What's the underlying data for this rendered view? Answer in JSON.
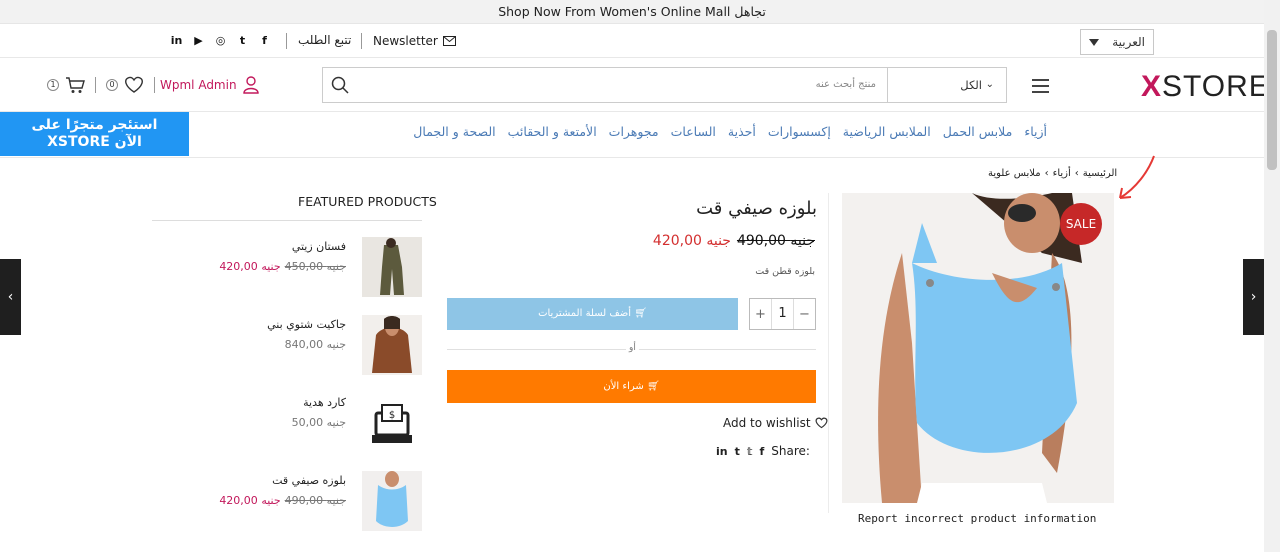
{
  "promo": {
    "text": "Shop Now From Women's Online Mall تجاهل"
  },
  "topbar": {
    "language": "العربية",
    "newsletter": "Newsletter",
    "track_order": "تتبع الطلب",
    "socials": [
      "in",
      "▶",
      "◎",
      "t",
      "f"
    ]
  },
  "header": {
    "logo_x": "X",
    "logo_rest": "STORE",
    "search_category": "الكل",
    "search_placeholder": "منتج أبحث عنه",
    "account_label": "Wpml Admin",
    "wishlist_count": "0",
    "cart_count": "1"
  },
  "nav": {
    "cta": "استئجر متجرًا على XSTORE الآن",
    "links": [
      "أزياء",
      "ملابس الحمل",
      "الملابس الرياضية",
      "إكسسوارات",
      "أحذية",
      "الساعات",
      "مجوهرات",
      "الأمتعة و الحقائب",
      "الصحة و الجمال"
    ]
  },
  "breadcrumb": {
    "home": "الرئيسية",
    "category": "أزياء",
    "current": "ملابس علوية"
  },
  "product": {
    "title": "بلوزه صيفي قت",
    "old_price": "490,00 جنيه",
    "new_price": "420,00 جنيه",
    "short_desc": "بلوزه قطن قت",
    "quantity": "1",
    "qty_minus": "−",
    "qty_plus": "+",
    "add_to_cart": "أضف لسلة المشتريات",
    "or": "أو",
    "buy_now": "شراء الأن",
    "wishlist": "Add to wishlist",
    "share": "Share:",
    "share_icons": [
      "in",
      "t",
      "𝕥",
      "f"
    ],
    "sale_badge": "SALE",
    "report": "Report incorrect product information"
  },
  "featured": {
    "heading": "FEATURED PRODUCTS",
    "items": [
      {
        "name": "فستان زيتي",
        "old": "450,00 جنيه",
        "new": "420,00 جنيه"
      },
      {
        "name": "جاكيت شتوي بني",
        "old": "",
        "new": "840,00 جنيه"
      },
      {
        "name": "كارد هدية",
        "old": "",
        "new": "50,00 جنيه"
      },
      {
        "name": "بلوزه صيفي قت",
        "old": "490,00 جنيه",
        "new": "420,00 جنيه"
      }
    ]
  },
  "colors": {
    "brand": "#c2185b",
    "cta": "#2196f3",
    "buy": "#ff7a00",
    "add": "#8ec5e6",
    "sale": "#c62828"
  }
}
